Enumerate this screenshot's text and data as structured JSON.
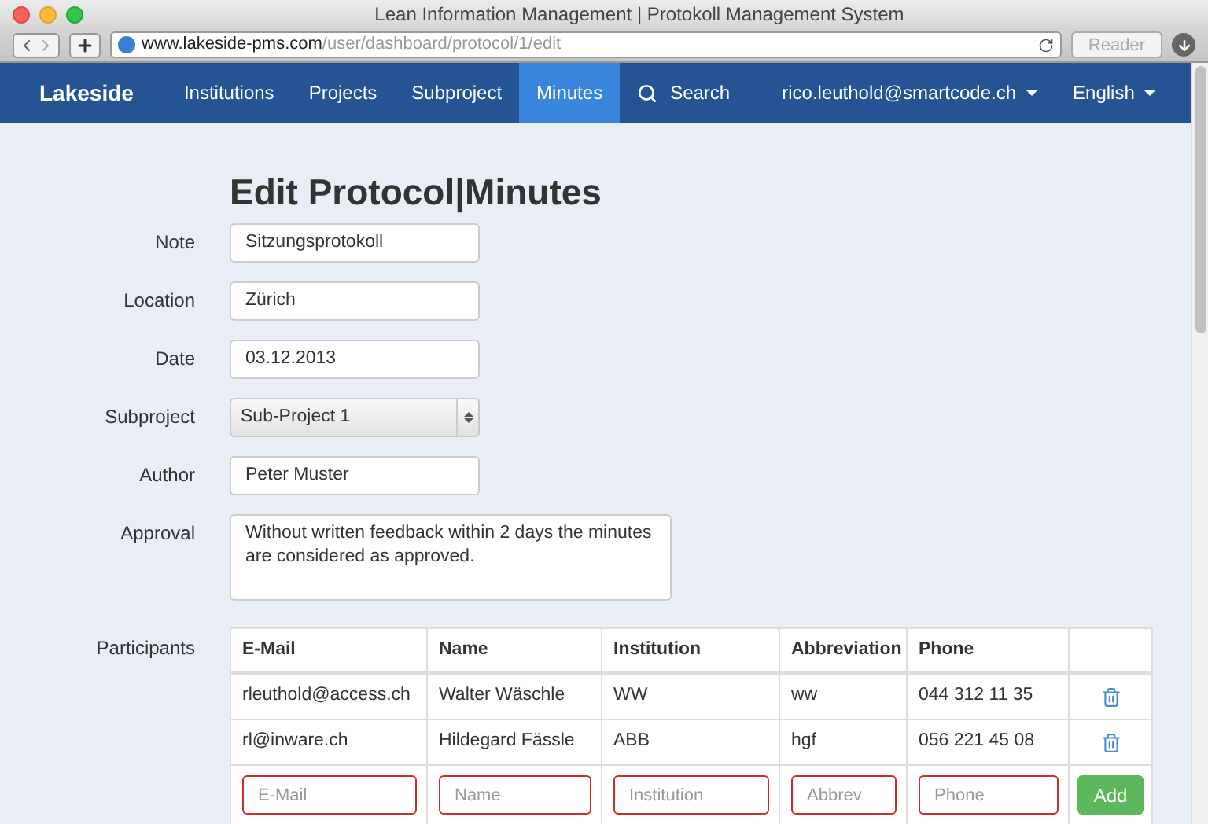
{
  "window": {
    "title": "Lean Information Management | Protokoll Management System"
  },
  "toolbar": {
    "url_host": "www.lakeside-pms.com",
    "url_path": "/user/dashboard/protocol/1/edit",
    "reader": "Reader"
  },
  "navbar": {
    "brand": "Lakeside",
    "items": [
      {
        "label": "Institutions",
        "selected": false,
        "kind": "link"
      },
      {
        "label": "Projects",
        "selected": false,
        "kind": "link"
      },
      {
        "label": "Subproject",
        "selected": false,
        "kind": "link"
      },
      {
        "label": "Minutes",
        "selected": true,
        "kind": "link"
      },
      {
        "label": "Search",
        "selected": false,
        "kind": "search"
      }
    ],
    "right": [
      {
        "label": "rico.leuthold@smartcode.ch"
      },
      {
        "label": "English"
      }
    ]
  },
  "heading": "Edit Protocol|Minutes",
  "form": [
    {
      "label": "Note",
      "kind": "text",
      "value": "Sitzungsprotokoll"
    },
    {
      "label": "Location",
      "kind": "text",
      "value": "Zürich"
    },
    {
      "label": "Date",
      "kind": "text",
      "value": "03.12.2013"
    },
    {
      "label": "Subproject",
      "kind": "select",
      "value": "Sub-Project 1"
    },
    {
      "label": "Author",
      "kind": "text",
      "value": "Peter Muster"
    },
    {
      "label": "Approval",
      "kind": "textarea",
      "value": "Without written feedback within 2 days the minutes are considered as approved."
    }
  ],
  "participants": {
    "label": "Participants",
    "columns": [
      "E-Mail",
      "Name",
      "Institution",
      "Abbreviation",
      "Phone"
    ],
    "rows": [
      [
        "rleuthold@access.ch",
        "Walter Wäschle",
        "WW",
        "ww",
        "044 312 11 35"
      ],
      [
        "rl@inware.ch",
        "Hildegard Fässle",
        "ABB",
        "hgf",
        "056 221 45 08"
      ]
    ],
    "new_row": {
      "placeholders": [
        "E-Mail",
        "Name",
        "Institution",
        "Abbrev",
        "Phone"
      ],
      "button": "Add"
    }
  }
}
